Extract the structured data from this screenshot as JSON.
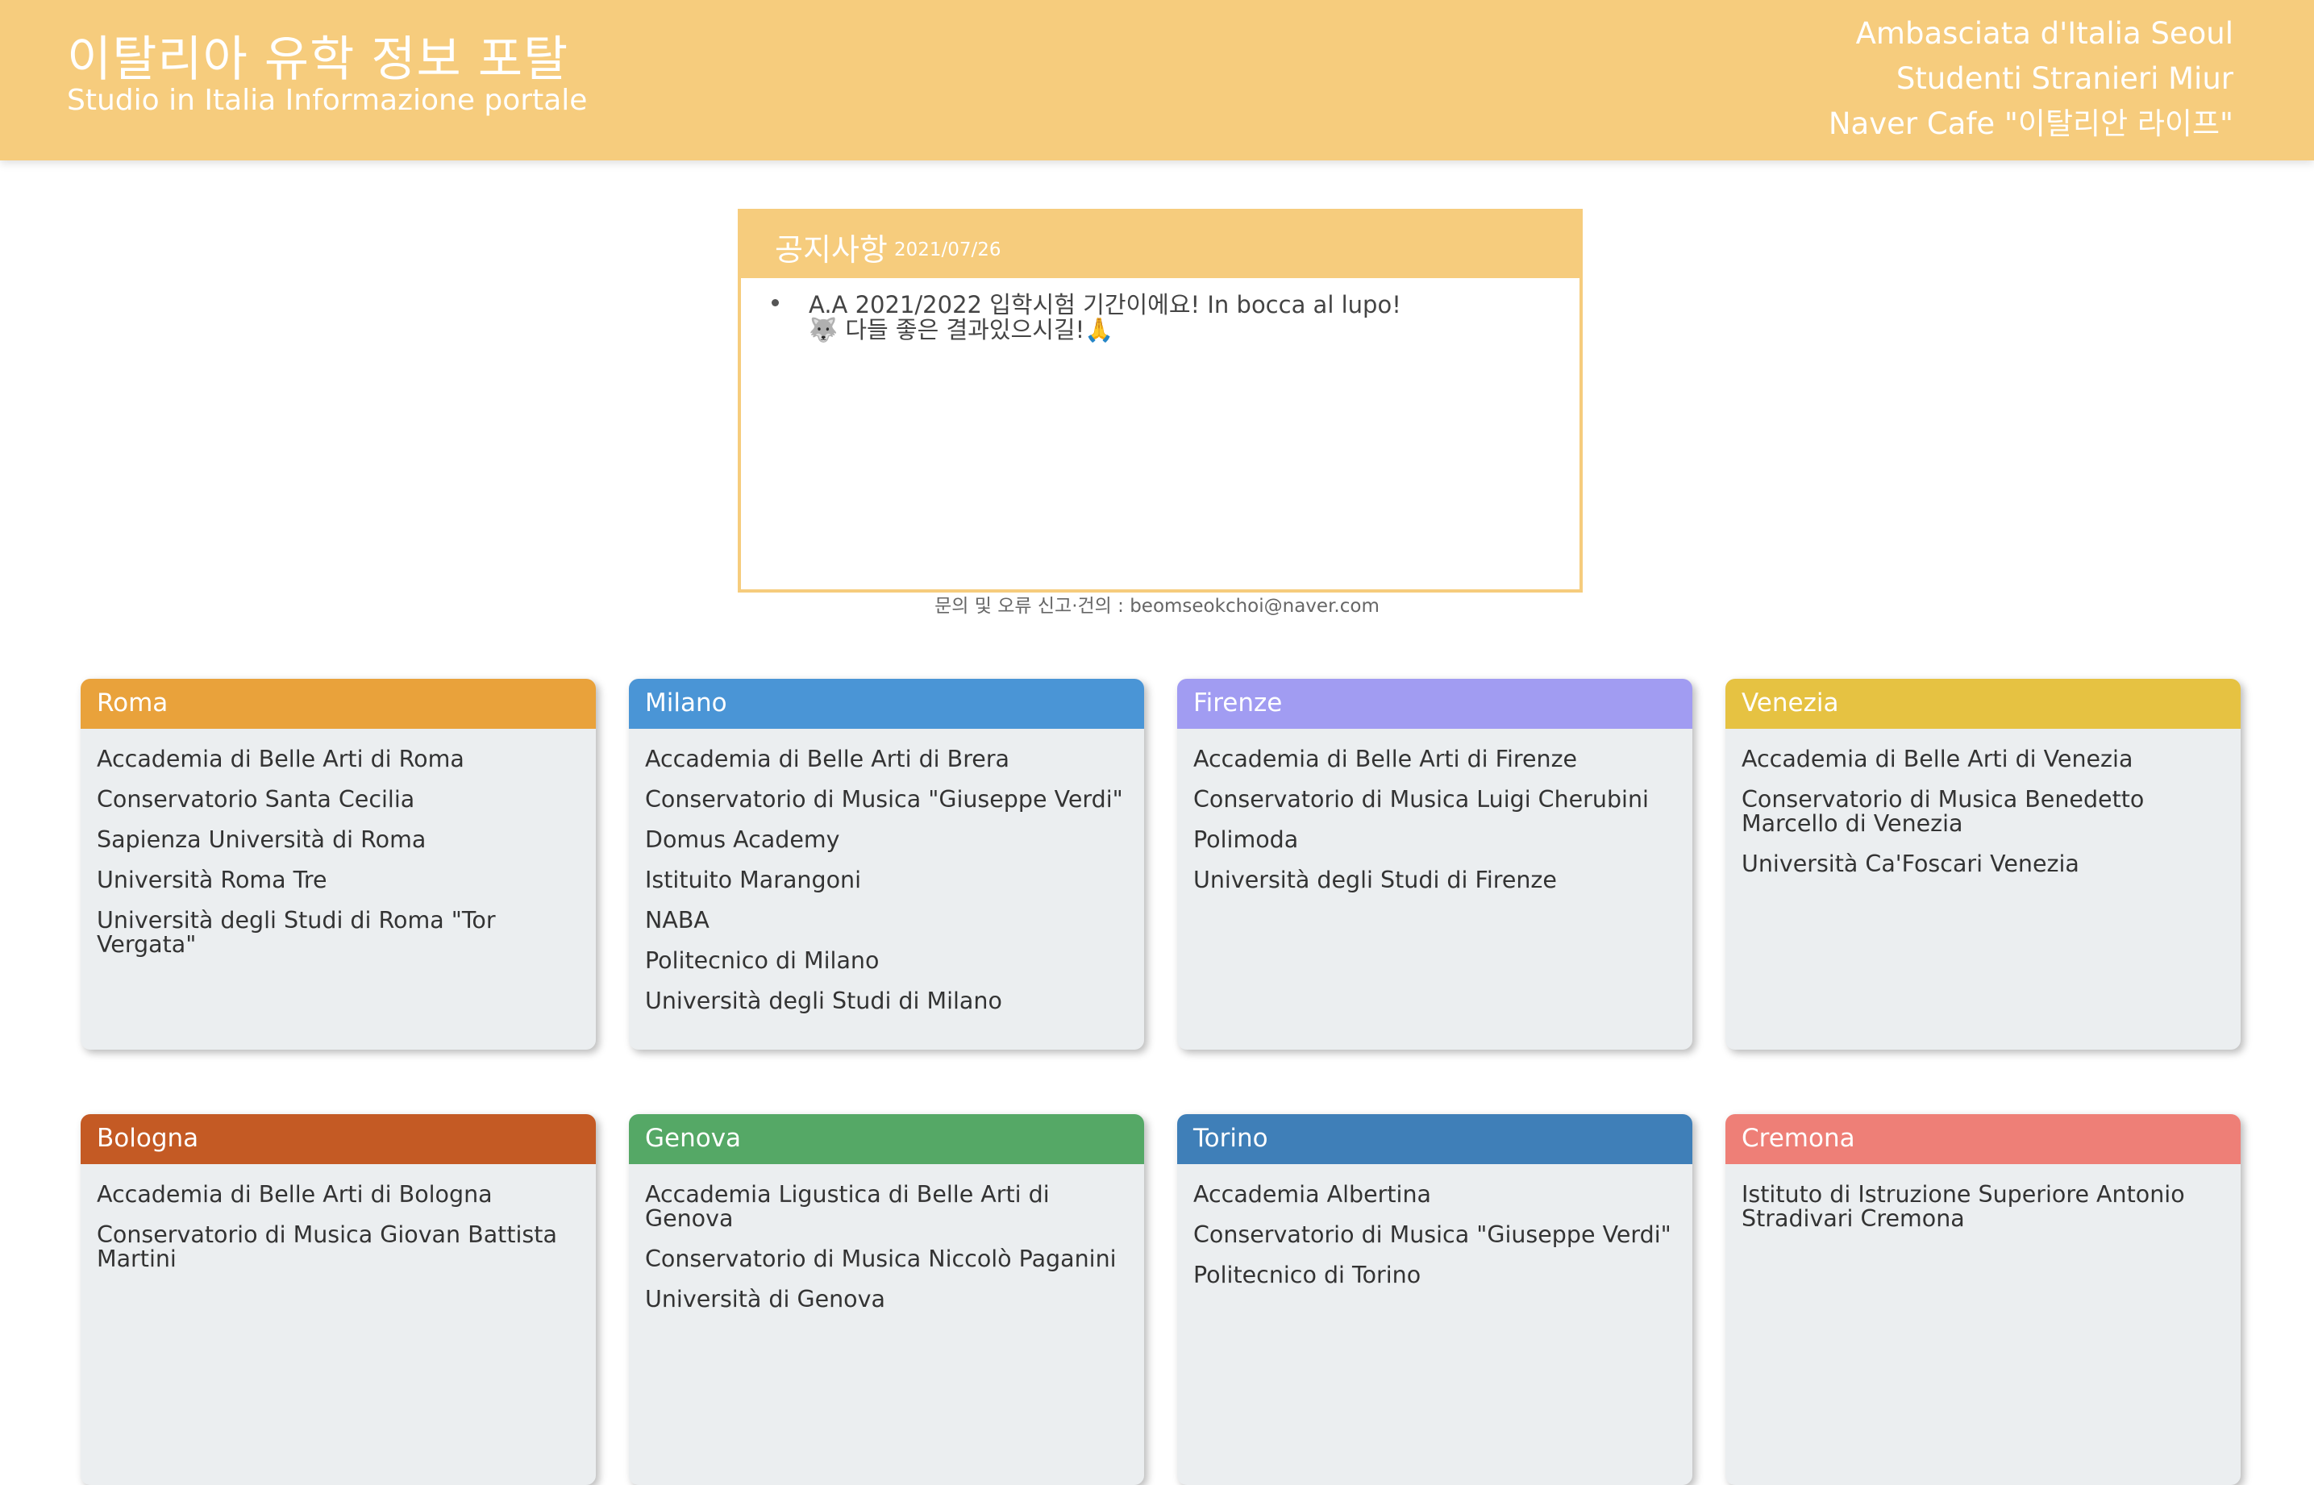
{
  "header": {
    "title": "이탈리아 유학 정보 포탈",
    "subtitle": "Studio in Italia Informazione portale",
    "links": [
      "Ambasciata d'Italia Seoul",
      "Studenti Stranieri Miur",
      "Naver Cafe \"이탈리안 라이프\""
    ],
    "background": "#f6cc7d"
  },
  "notice": {
    "title": "공지사항",
    "date": "2021/07/26",
    "items": [
      "A.A 2021/2022 입학시험 기간이에요! In bocca al lupo!🐺 다들 좋은 결과있으시길!🙏"
    ]
  },
  "contact": "문의 및 오류 신고·건의 : beomseokchoi@naver.com",
  "cities": [
    {
      "name": "Roma",
      "color": "#e9a23b",
      "schools": [
        "Accademia di Belle Arti di Roma",
        "Conservatorio Santa Cecilia",
        "Sapienza Università di Roma",
        "Università Roma Tre",
        "Università degli Studi di Roma \"Tor Vergata\""
      ]
    },
    {
      "name": "Milano",
      "color": "#4a95d6",
      "schools": [
        "Accademia di Belle Arti di Brera",
        "Conservatorio di Musica \"Giuseppe Verdi\"",
        "Domus Academy",
        "Istituito Marangoni",
        "NABA",
        "Politecnico di Milano",
        "Università degli Studi di Milano"
      ]
    },
    {
      "name": "Firenze",
      "color": "#a19cf2",
      "schools": [
        "Accademia di Belle Arti di Firenze",
        "Conservatorio di Musica Luigi Cherubini",
        "Polimoda",
        "Università degli Studi di Firenze"
      ]
    },
    {
      "name": "Venezia",
      "color": "#e6c242",
      "schools": [
        "Accademia di Belle Arti di Venezia",
        "Conservatorio di Musica Benedetto Marcello di Venezia",
        "Università Ca'Foscari Venezia"
      ]
    },
    {
      "name": "Bologna",
      "color": "#c45a24",
      "schools": [
        "Accademia di Belle Arti di Bologna",
        "Conservatorio di Musica Giovan Battista Martini"
      ]
    },
    {
      "name": "Genova",
      "color": "#55a866",
      "schools": [
        "Accademia Ligustica di Belle Arti di Genova",
        "Conservatorio di Musica Niccolò Paganini",
        "Università di Genova"
      ]
    },
    {
      "name": "Torino",
      "color": "#3f7fb8",
      "schools": [
        "Accademia Albertina",
        "Conservatorio di Musica \"Giuseppe Verdi\"",
        "Politecnico di Torino"
      ]
    },
    {
      "name": "Cremona",
      "color": "#ee7f77",
      "schools": [
        "Istituto di Istruzione Superiore Antonio Stradivari Cremona"
      ]
    }
  ]
}
